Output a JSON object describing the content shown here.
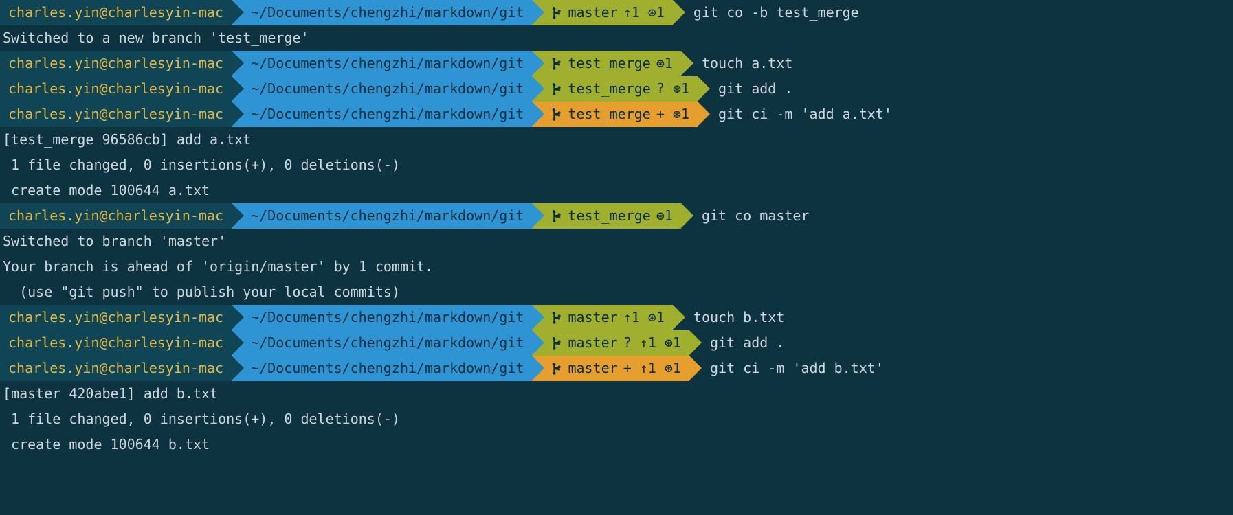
{
  "colors": {
    "bg": "#0d3340",
    "user_bg": "#0f4554",
    "user_fg": "#e0b84a",
    "path_bg": "#2e94d4",
    "branch_green": "#a0b02e",
    "branch_orange": "#e69f2e"
  },
  "icons": {
    "git_branch": "git-branch-icon"
  },
  "lines": [
    {
      "type": "prompt",
      "user": "charles.yin@charlesyin-mac",
      "path": "~/Documents/chengzhi/markdown/git",
      "branch": {
        "name": "master",
        "status": "↑1 ⊛1",
        "style": "green"
      },
      "command": "git co -b test_merge"
    },
    {
      "type": "output",
      "text": "Switched to a new branch 'test_merge'"
    },
    {
      "type": "prompt",
      "user": "charles.yin@charlesyin-mac",
      "path": "~/Documents/chengzhi/markdown/git",
      "branch": {
        "name": "test_merge",
        "status": "⊛1",
        "style": "green"
      },
      "command": "touch a.txt"
    },
    {
      "type": "prompt",
      "user": "charles.yin@charlesyin-mac",
      "path": "~/Documents/chengzhi/markdown/git",
      "branch": {
        "name": "test_merge",
        "status": "? ⊛1",
        "style": "green"
      },
      "command": "git add ."
    },
    {
      "type": "prompt",
      "user": "charles.yin@charlesyin-mac",
      "path": "~/Documents/chengzhi/markdown/git",
      "branch": {
        "name": "test_merge",
        "status": "+ ⊛1",
        "style": "orange"
      },
      "command": "git ci -m 'add a.txt'"
    },
    {
      "type": "output",
      "text": "[test_merge 96586cb] add a.txt"
    },
    {
      "type": "output",
      "text": " 1 file changed, 0 insertions(+), 0 deletions(-)"
    },
    {
      "type": "output",
      "text": " create mode 100644 a.txt"
    },
    {
      "type": "prompt",
      "user": "charles.yin@charlesyin-mac",
      "path": "~/Documents/chengzhi/markdown/git",
      "branch": {
        "name": "test_merge",
        "status": "⊛1",
        "style": "green"
      },
      "command": "git co master"
    },
    {
      "type": "output",
      "text": "Switched to branch 'master'"
    },
    {
      "type": "output",
      "text": "Your branch is ahead of 'origin/master' by 1 commit."
    },
    {
      "type": "output",
      "text": "  (use \"git push\" to publish your local commits)"
    },
    {
      "type": "prompt",
      "user": "charles.yin@charlesyin-mac",
      "path": "~/Documents/chengzhi/markdown/git",
      "branch": {
        "name": "master",
        "status": "↑1 ⊛1",
        "style": "green"
      },
      "command": "touch b.txt"
    },
    {
      "type": "prompt",
      "user": "charles.yin@charlesyin-mac",
      "path": "~/Documents/chengzhi/markdown/git",
      "branch": {
        "name": "master",
        "status": "? ↑1 ⊛1",
        "style": "green"
      },
      "command": "git add ."
    },
    {
      "type": "prompt",
      "user": "charles.yin@charlesyin-mac",
      "path": "~/Documents/chengzhi/markdown/git",
      "branch": {
        "name": "master",
        "status": "+ ↑1 ⊛1",
        "style": "orange"
      },
      "command": "git ci -m 'add b.txt'"
    },
    {
      "type": "output",
      "text": "[master 420abe1] add b.txt"
    },
    {
      "type": "output",
      "text": " 1 file changed, 0 insertions(+), 0 deletions(-)"
    },
    {
      "type": "output",
      "text": " create mode 100644 b.txt"
    }
  ]
}
